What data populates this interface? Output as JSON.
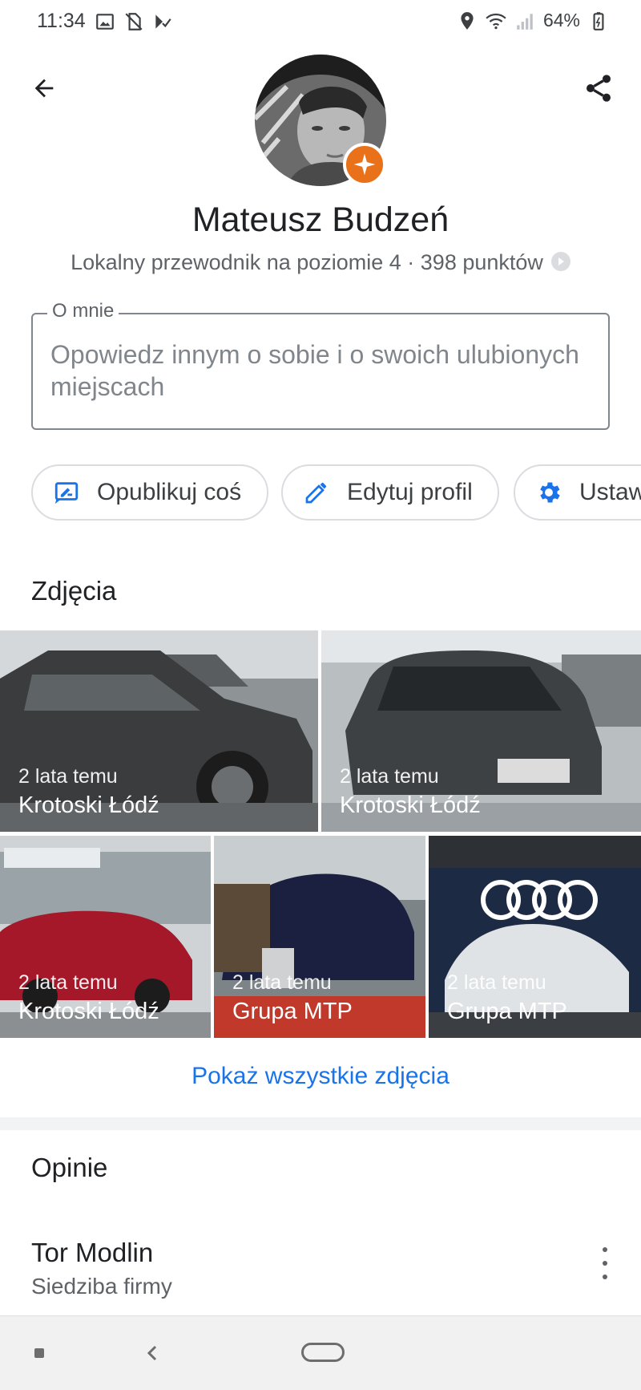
{
  "status_bar": {
    "time": "11:34",
    "battery": "64%"
  },
  "profile": {
    "name": "Mateusz Budzeń",
    "subtitle": "Lokalny przewodnik na poziomie 4 · 398 punktów",
    "badge_color": "#e8711a"
  },
  "about": {
    "label": "O mnie",
    "placeholder": "Opowiedz innym o sobie i o swoich ulubionych miejscach"
  },
  "actions": {
    "post_label": "Opublikuj coś",
    "edit_label": "Edytuj profil",
    "settings_label": "Ustaw"
  },
  "photos_section": {
    "title": "Zdjęcia",
    "items": [
      {
        "time": "2 lata temu",
        "place": "Krotoski Łódź"
      },
      {
        "time": "2 lata temu",
        "place": "Krotoski Łódź"
      },
      {
        "time": "2 lata temu",
        "place": "Krotoski Łódź"
      },
      {
        "time": "2 lata temu",
        "place": "Grupa MTP"
      },
      {
        "time": "2 lata temu",
        "place": "Grupa MTP"
      }
    ],
    "show_all": "Pokaż wszystkie zdjęcia"
  },
  "reviews_section": {
    "title": "Opinie",
    "items": [
      {
        "name": "Tor Modlin",
        "category": "Siedziba firmy"
      }
    ]
  },
  "colors": {
    "accent": "#1a73e8",
    "icon_blue": "#1a73e8"
  }
}
